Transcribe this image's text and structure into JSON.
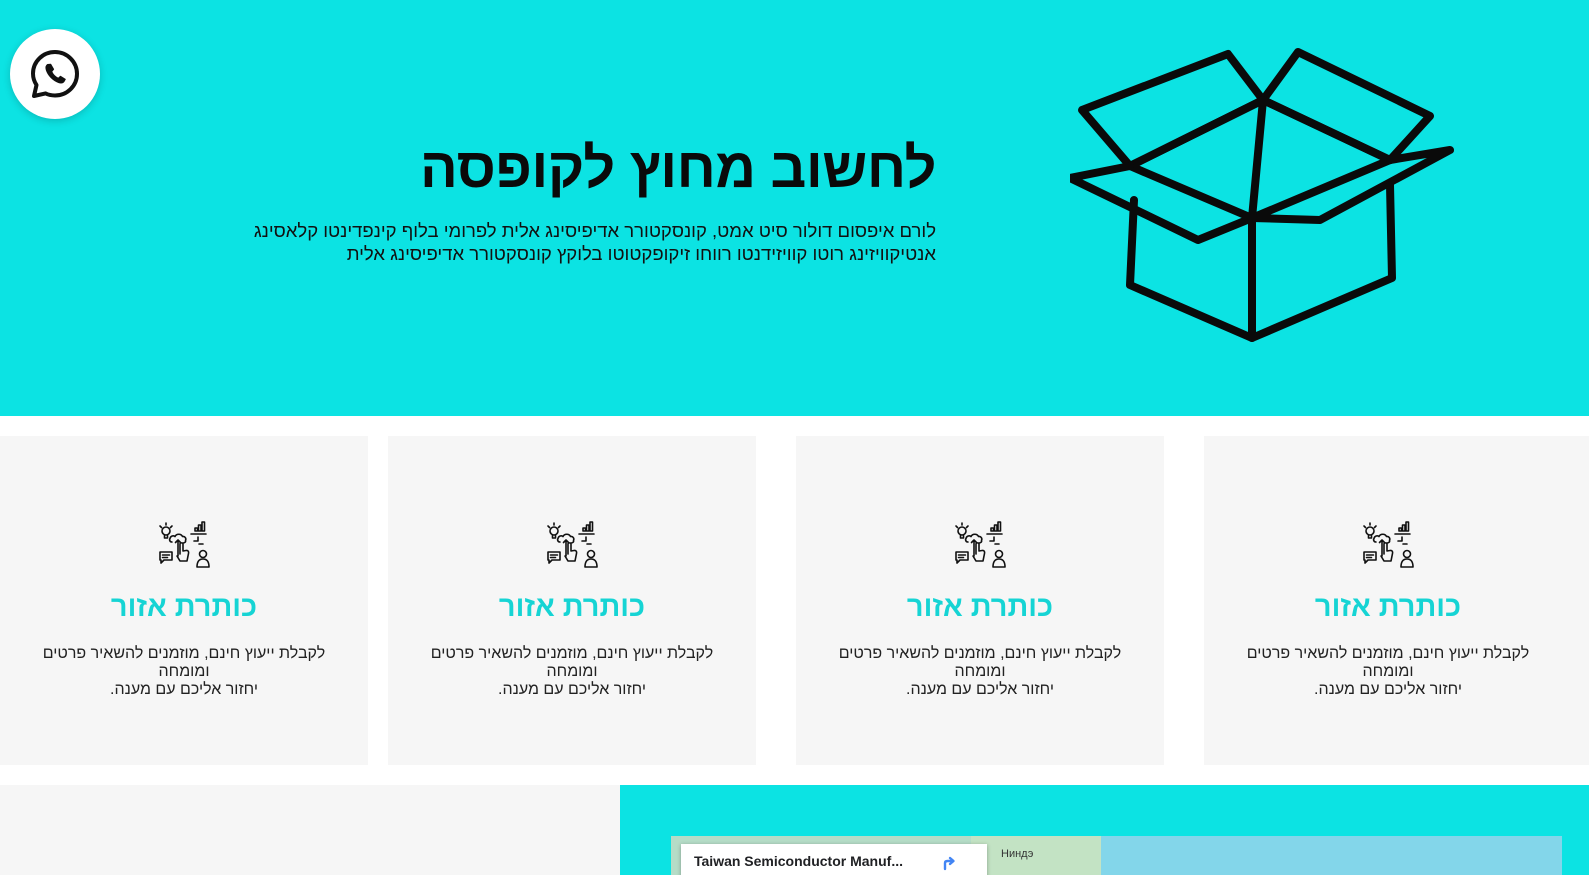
{
  "hero": {
    "title": "לחשוב מחוץ לקופסה",
    "text_line1": "לורם איפסום דולור סיט אמט, קונסקטורר אדיפיסינג אלית לפרומי בלוף קינפדינטו קלאסינג",
    "text_line2": "אנטיקוויזינג רוטו קוויזידנטו רווחו זיקופקטוטו בלוקץ קונסקטורר אדיפיסינג אלית",
    "background_color": "#0ce3e3",
    "art_icon": "open-box-icon"
  },
  "whatsapp": {
    "icon": "whatsapp-icon"
  },
  "cards": [
    {
      "icon": "digital-marketing-icon",
      "title": "כותרת אזור",
      "text_line1": "לקבלת ייעוץ חינם, מוזמנים להשאיר פרטים ומומחה",
      "text_line2": "יחזור אליכם עם מענה."
    },
    {
      "icon": "digital-marketing-icon",
      "title": "כותרת אזור",
      "text_line1": "לקבלת ייעוץ חינם, מוזמנים להשאיר פרטים ומומחה",
      "text_line2": "יחזור אליכם עם מענה."
    },
    {
      "icon": "digital-marketing-icon",
      "title": "כותרת אזור",
      "text_line1": "לקבלת ייעוץ חינם, מוזמנים להשאיר פרטים ומומחה",
      "text_line2": "יחזור אליכם עם מענה."
    },
    {
      "icon": "digital-marketing-icon",
      "title": "כותרת אזור",
      "text_line1": "לקבלת ייעוץ חינם, מוזמנים להשאיר פרטים ומומחה",
      "text_line2": "יחזור אליכם עם מענה."
    }
  ],
  "card_title_color": "#16d4d4",
  "map": {
    "place_name": "Taiwan Semiconductor Manuf...",
    "region_label": "Ниндэ",
    "directions_icon": "directions-icon"
  }
}
